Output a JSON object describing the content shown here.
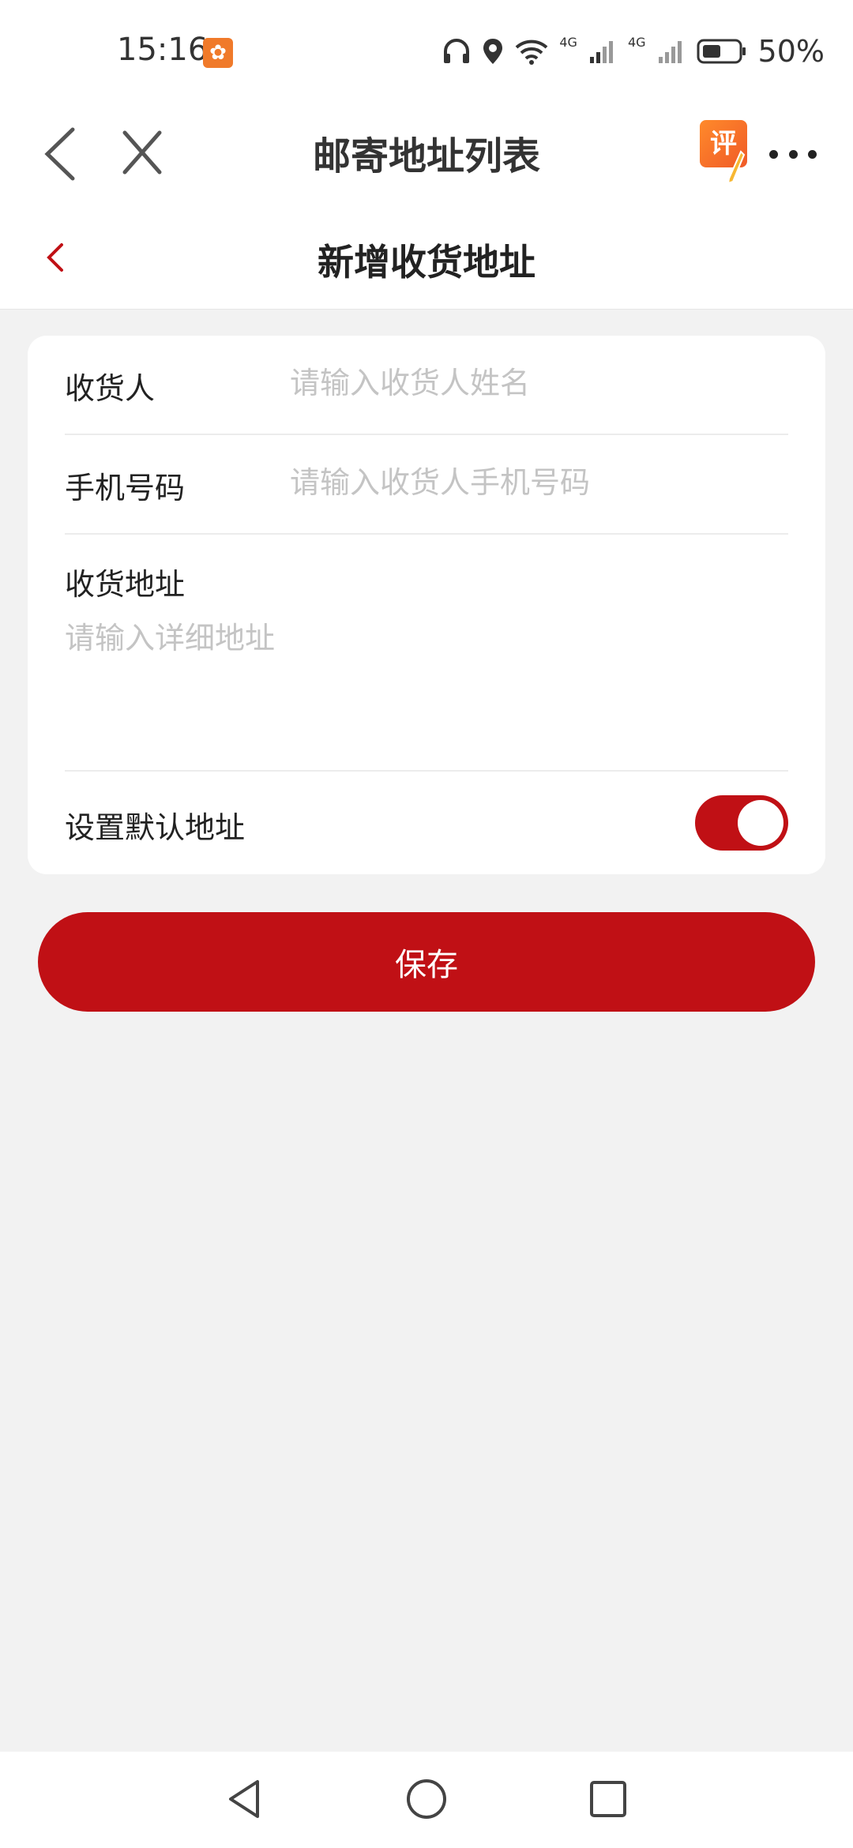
{
  "status_bar": {
    "time": "15:16",
    "app_notification_glyph": "✿",
    "network_1": "4G",
    "network_2": "4G",
    "battery": "50%",
    "icons": [
      "headphones-icon",
      "location-icon",
      "wifi-icon",
      "signal-icon",
      "signal-icon",
      "battery-icon"
    ]
  },
  "nav": {
    "title": "邮寄地址列表",
    "rate_badge": "评",
    "icons": [
      "back-icon",
      "close-icon",
      "rate-icon",
      "more-icon"
    ]
  },
  "page": {
    "title": "新增收货地址"
  },
  "form": {
    "name_label": "收货人",
    "name_placeholder": "请输入收货人姓名",
    "phone_label": "手机号码",
    "phone_placeholder": "请输入收货人手机号码",
    "address_label": "收货地址",
    "address_placeholder": "请输入详细地址",
    "default_label": "设置默认地址",
    "default_enabled": true
  },
  "save_label": "保存",
  "colors": {
    "accent": "#c01015",
    "background": "#f2f2f2",
    "placeholder": "#c4c4c4"
  }
}
